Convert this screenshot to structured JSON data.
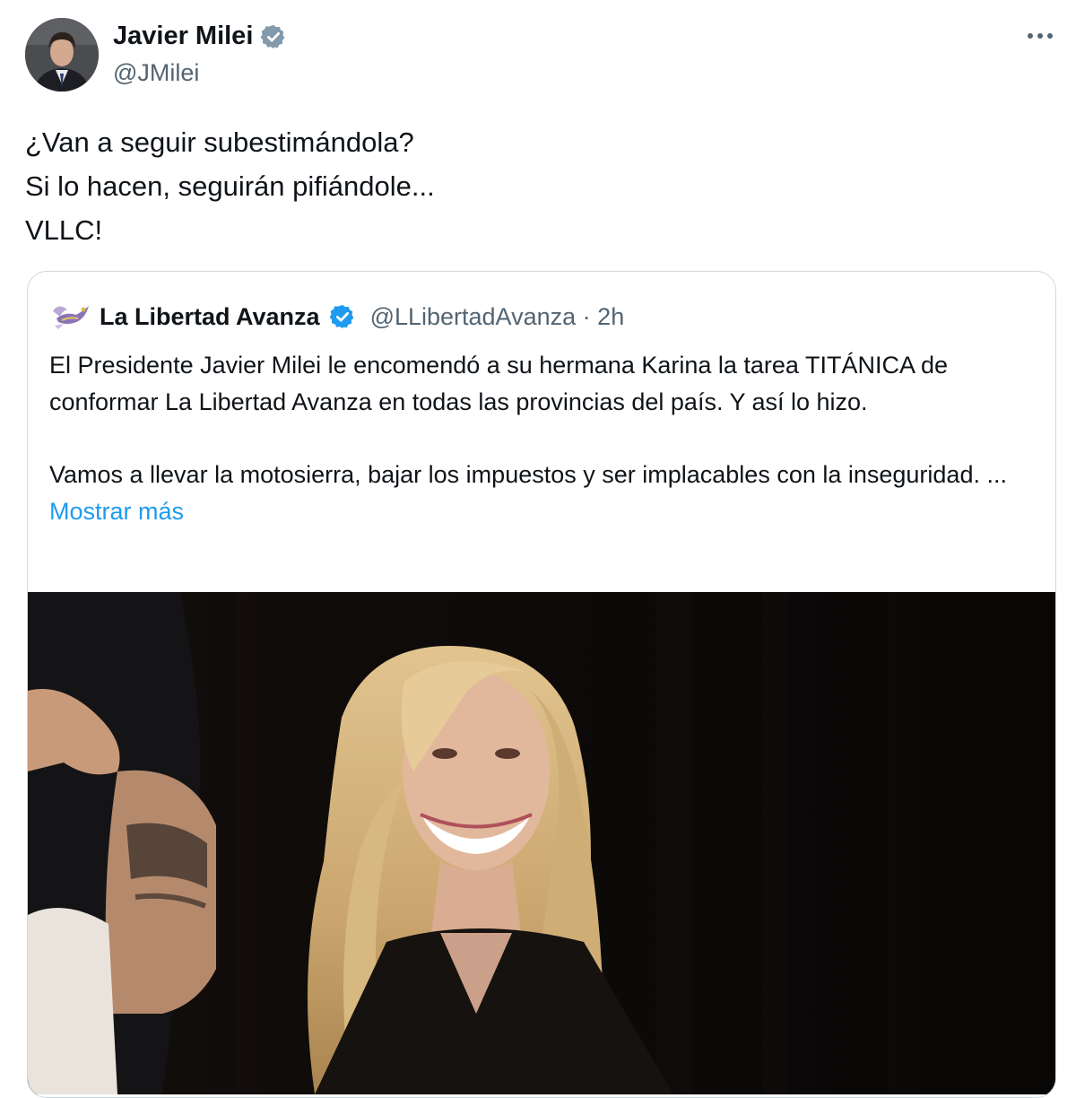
{
  "tweet": {
    "author": {
      "name": "Javier Milei",
      "handle": "@JMilei",
      "verified": true,
      "verified_badge_color": "#829aab"
    },
    "more_icon": "ellipsis-icon",
    "lines": [
      "¿Van a seguir subestimándola?",
      "Si lo hacen, seguirán pifiándole...",
      "VLLC!"
    ]
  },
  "quoted": {
    "author": {
      "name": "La Libertad Avanza",
      "handle": "@LLibertadAvanza",
      "separator": "·",
      "time": "2h",
      "verified": true,
      "verified_badge_color": "#1d9bf0"
    },
    "paragraph1": "El Presidente Javier Milei le encomendó a su hermana Karina la tarea TITÁNICA de conformar La Libertad Avanza en todas las provincias del país. Y así lo hizo.",
    "paragraph2": "Vamos a llevar la motosierra, bajar los impuestos y ser implacables con la inseguridad. ...",
    "show_more": "Mostrar más",
    "link_color": "#1d9bf0",
    "media_icon": "photo-icon"
  }
}
